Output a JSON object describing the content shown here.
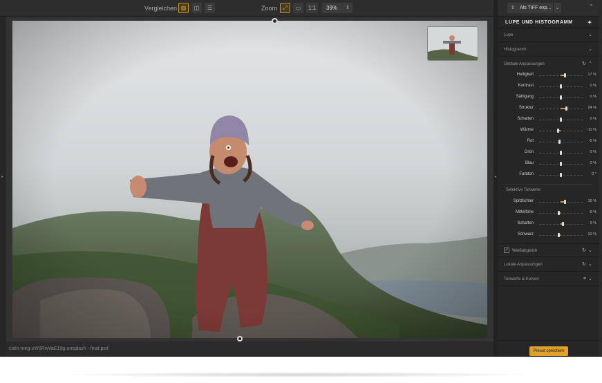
{
  "toolbar": {
    "compare_label": "Vergleichen",
    "zoom_label": "Zoom",
    "zoom_1to1": "1:1",
    "zoom_value": "39%"
  },
  "status": {
    "filename": "colin-meg-vW0RwVaE19g-unsplash - final.psd"
  },
  "panel": {
    "export_label": "Als TIFF exp...",
    "section_title": "LUPE UND HISTOGRAMM",
    "lupe": "Lupe",
    "histogramm": "Histogramm",
    "globale": "Globale Anpassungen",
    "selektive": "Selektive Tonwerte",
    "weissabgleich": "Weißabgleich",
    "lokale": "Lokale Anpassungen",
    "tonwerte": "Tonwerte & Kurven",
    "preset_button": "Preset speichern",
    "global_sliders": [
      {
        "label": "Helligkeit",
        "value": 17,
        "value_text": "17 %"
      },
      {
        "label": "Kontrast",
        "value": 0,
        "value_text": "0 %"
      },
      {
        "label": "Sättigung",
        "value": 0,
        "value_text": "0 %"
      },
      {
        "label": "Struktur",
        "value": 24,
        "value_text": "24 %"
      },
      {
        "label": "Schatten",
        "value": 0,
        "value_text": "0 %"
      },
      {
        "label": "Wärme",
        "value": -11,
        "value_text": "-11 %"
      },
      {
        "label": "Rot",
        "value": -5,
        "value_text": "-5 %"
      },
      {
        "label": "Grün",
        "value": 0,
        "value_text": "0 %"
      },
      {
        "label": "Blau",
        "value": 0,
        "value_text": "0 %"
      },
      {
        "label": "Farbton",
        "value": 0,
        "value_text": "0 °"
      }
    ],
    "selective_sliders": [
      {
        "label": "Spitzlichter",
        "value": 16,
        "value_text": "16 %"
      },
      {
        "label": "Mitteltöne",
        "value": -9,
        "value_text": "-9 %"
      },
      {
        "label": "Schatten",
        "value": 9,
        "value_text": "9 %"
      },
      {
        "label": "Schwarz",
        "value": -10,
        "value_text": "-10 %"
      }
    ]
  },
  "colors": {
    "accent": "#e0a12a"
  }
}
